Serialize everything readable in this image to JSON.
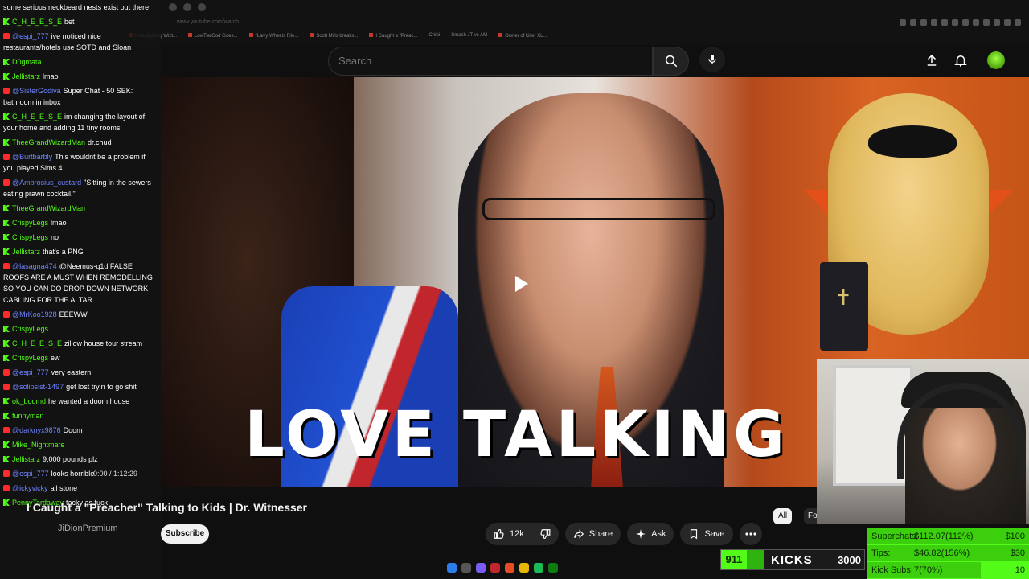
{
  "browser": {
    "url": "www.youtube.com/watch",
    "bookmarks": [
      "Investigating Wizt...",
      "LowTierGod Goes...",
      "\"Larry Wheels File...",
      "Scott Mills breaks...",
      "I Caught a \"Preac...",
      "Chibi",
      "Smash JT vs AM",
      "Owner of killer XL..."
    ]
  },
  "header": {
    "search_placeholder": "Search",
    "icons": [
      "search-icon",
      "mic-icon",
      "upload-icon",
      "bell-icon",
      "avatar"
    ]
  },
  "video": {
    "headline": "LOVE TALKING",
    "title": "I Caught a \"Preacher\" Talking to Kids | Dr. Witnesser",
    "channel": "JiDionPremium",
    "time": "0:00 / 1:12:29"
  },
  "actions": {
    "subscribe": "Subscribe",
    "likes": "12k",
    "share": "Share",
    "ask": "Ask",
    "save": "Save"
  },
  "chips": {
    "all": "All",
    "next": "Fo"
  },
  "chat": [
    {
      "badge": "none",
      "user": "",
      "text": "some serious neckbeard nests exist out there"
    },
    {
      "badge": "k",
      "user": "C_H_E_E_S_E",
      "text": "bet"
    },
    {
      "badge": "y",
      "user": "@espi_777",
      "text": "ive noticed nice restaurants/hotels use SOTD and Sloan"
    },
    {
      "badge": "k",
      "user": "D0gmata",
      "text": ""
    },
    {
      "badge": "k",
      "user": "Jellistarz",
      "text": "lmao"
    },
    {
      "badge": "y",
      "user": "@SisterGodiva",
      "text": "Super Chat - 50 SEK: bathroom in inbox"
    },
    {
      "badge": "k",
      "user": "C_H_E_E_S_E",
      "text": "im changing the layout of your home and adding 11 tiny rooms"
    },
    {
      "badge": "k",
      "user": "TheeGrandWizardMan",
      "text": "dr.chud"
    },
    {
      "badge": "y",
      "user": "@Burtbarbly",
      "text": "This wouldnt be a problem if you played Sims 4"
    },
    {
      "badge": "y",
      "user": "@Ambrosius_custard",
      "text": "\"Sitting in the sewers eating prawn cocktail.\""
    },
    {
      "badge": "k",
      "user": "TheeGrandWizardMan",
      "text": ""
    },
    {
      "badge": "k",
      "user": "CrispyLegs",
      "text": "lmao"
    },
    {
      "badge": "k",
      "user": "CrispyLegs",
      "text": "no"
    },
    {
      "badge": "k",
      "user": "Jellistarz",
      "text": "that's a PNG"
    },
    {
      "badge": "y",
      "user": "@lasagna474",
      "text": "@Neemus-q1d FALSE ROOFS ARE A MUST WHEN REMODELLING SO YOU CAN DO DROP DOWN NETWORK CABLING FOR THE ALTAR"
    },
    {
      "badge": "y",
      "user": "@MrKoo1928",
      "text": "EEEWW"
    },
    {
      "badge": "k",
      "user": "CrispyLegs",
      "text": ""
    },
    {
      "badge": "k",
      "user": "C_H_E_E_S_E",
      "text": "zillow house tour stream"
    },
    {
      "badge": "k",
      "user": "CrispyLegs",
      "text": "ew"
    },
    {
      "badge": "y",
      "user": "@espi_777",
      "text": "very eastern"
    },
    {
      "badge": "y",
      "user": "@solipsist-1497",
      "text": "get lost tryin to go shit"
    },
    {
      "badge": "k",
      "user": "ok_boomd",
      "text": "he wanted a doom house"
    },
    {
      "badge": "k",
      "user": "funnyman",
      "text": ""
    },
    {
      "badge": "y",
      "user": "@darknyx9876",
      "text": "Doom"
    },
    {
      "badge": "k",
      "user": "Mike_Nightmare",
      "text": ""
    },
    {
      "badge": "k",
      "user": "Jellistarz",
      "text": "9,000 pounds plz"
    },
    {
      "badge": "y",
      "user": "@espi_777",
      "text": "looks horrible"
    },
    {
      "badge": "y",
      "user": "@ickyvicky",
      "text": "all stone"
    },
    {
      "badge": "k",
      "user": "PennyTardaway",
      "text": "tacky as fuck"
    }
  ],
  "kicks": {
    "count": "911",
    "label": "KICKS",
    "goal": "3000",
    "progress": 0.3
  },
  "goals": [
    {
      "label": "Superchats:",
      "value": "$112.07(112%)",
      "target": "$100",
      "progress": 1.0
    },
    {
      "label": "Tips:",
      "value": "$46.82(156%)",
      "target": "$30",
      "progress": 1.0
    },
    {
      "label": "Kick Subs:",
      "value": "7(70%)",
      "target": "10",
      "progress": 0.7
    }
  ],
  "colors": {
    "kick_green": "#53fc18",
    "yt_red": "#ff0000",
    "bg": "#0f0f0f"
  }
}
